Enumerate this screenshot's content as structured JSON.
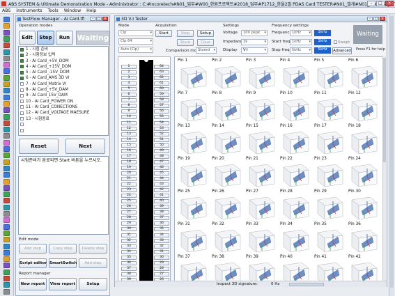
{
  "window": {
    "title": "ABS SYSTEM & Ultimate Demonstration Mode - Administrator : C:#Incoretech#N01_업무#W00_한원프로젝트#2018_업무#P1712_한울2발 PDAS Card TESTER#N01_발개#N01_PDAS Edge Tester#N05_"
  },
  "menu": [
    "ABS",
    "Instruments",
    "Tools",
    "Window",
    "Help"
  ],
  "left": {
    "title": "TestFlow Manager - AI Card.tfl",
    "operation_modes_label": "Operation modes",
    "modes": [
      "Edit",
      "Step",
      "Run"
    ],
    "active_mode": "Step",
    "waiting": "Waiting",
    "steps": [
      {
        "label": "1 - 시험 준비",
        "checked": true
      },
      {
        "label": "2 - 시험정보 입력",
        "checked": true
      },
      {
        "label": "3 - AI Card_+5V_DOM",
        "checked": true
      },
      {
        "label": "4 - AI Card_+15V_DOM",
        "checked": true
      },
      {
        "label": "5 - AI Card_-15V_DOM",
        "checked": true
      },
      {
        "label": "6 - AI Card_AMS 3D VI",
        "checked": true
      },
      {
        "label": "7 - AI Card_Matrix VI",
        "checked": false
      },
      {
        "label": "8 - AI Card_+5V_DAM",
        "checked": false
      },
      {
        "label": "9 - AI Card_15V_DAM",
        "checked": false
      },
      {
        "label": "10 - AI Card_POWER ON",
        "checked": false
      },
      {
        "label": "11 - AI Card_CONECTIONS",
        "checked": false
      },
      {
        "label": "12 - AI Card_VOLTAGE MAESURE",
        "checked": false
      },
      {
        "label": "13 - 시험종료",
        "checked": false
      },
      {
        "label": "",
        "checked": false
      },
      {
        "label": "",
        "checked": false
      }
    ],
    "reset": "Reset",
    "next": "Next",
    "message": "시험준비가 완료되면 Start 버튼을 누르시오.",
    "edit_mode_label": "Edit mode",
    "edit_buttons": [
      "Add step",
      "Copy step",
      "Delete step",
      "Script editor",
      "SmartSwitch",
      "Add step"
    ],
    "report_label": "Report manager",
    "report_buttons": [
      "New report",
      "View report",
      "Setup"
    ]
  },
  "tester": {
    "title": "3D V-I Tester",
    "mode_label": "Mode",
    "mode_combos": [
      "Clp",
      "Clp 64",
      "Auto (Clp)"
    ],
    "acq_label": "Acquisition",
    "acq_buttons": [
      "Start",
      "Stop",
      "Setup",
      "Store",
      "Clear"
    ],
    "comparison_label": "Comparison mode",
    "comparison_value": "Stored",
    "settings_label": "Settings",
    "voltage_label": "Voltage",
    "voltage_value": "10V pkpk",
    "impedance_label": "Impedance",
    "impedance_value": "1k",
    "display_label": "Display",
    "display_value": "V-I",
    "freq_label": "Frequency settings",
    "frequency_label": "Frequency",
    "frequency_combo": "1kHz",
    "frequency_value": "1kHz",
    "start_label": "Start freq.",
    "start_combo": "1kHz",
    "start_value": "1kHz",
    "stop_label": "Stop freq.",
    "stop_combo": "5kHz",
    "stop_value": "5kHz",
    "swept": "Swept",
    "advanced": "Advanced",
    "waiting": "Waiting",
    "help_hint": "Press F1 for help",
    "pins_left": [
      "1",
      "2",
      "3",
      "4",
      "5",
      "6",
      "7",
      "8",
      "9",
      "10",
      "11",
      "12",
      "13",
      "14",
      "15",
      "16",
      "17",
      "18",
      "19",
      "20",
      "21",
      "22",
      "23",
      "24",
      "25",
      "26",
      "27",
      "28",
      "29",
      "30",
      "31",
      "32",
      "33",
      "34",
      "35",
      "36",
      "37",
      "38",
      "39",
      "40"
    ],
    "pins_right": [
      "64",
      "63",
      "62",
      "61",
      "60",
      "59",
      "58",
      "57",
      "56",
      "55",
      "54",
      "53",
      "52",
      "51",
      "50",
      "49",
      "48",
      "47",
      "46",
      "45",
      "44",
      "43",
      "42",
      "41",
      "40",
      "39",
      "38",
      "37",
      "36",
      "35",
      "34",
      "33",
      "32",
      "31",
      "30",
      "29",
      "28",
      "27",
      "26",
      "25"
    ],
    "cells": [
      "Pin 1",
      "Pin 2",
      "Pin 3",
      "Pin 4",
      "Pin 5",
      "Pin 6",
      "Pin 7",
      "Pin 8",
      "Pin 9",
      "Pin 10",
      "Pin 11",
      "Pin 12",
      "Pin 13",
      "Pin 14",
      "Pin 15",
      "Pin 16",
      "Pin 17",
      "Pin 18",
      "Pin 19",
      "Pin 20",
      "Pin 21",
      "Pin 22",
      "Pin 23",
      "Pin 24",
      "Pin 25",
      "Pin 26",
      "Pin 27",
      "Pin 28",
      "Pin 29",
      "Pin 30",
      "Pin 31",
      "Pin 32",
      "Pin 33",
      "Pin 34",
      "Pin 35",
      "Pin 36",
      "Pin 37",
      "Pin 38",
      "Pin 39",
      "Pin 40",
      "Pin 41",
      "Pin 42"
    ],
    "status_label": "Inspect 3D signature:",
    "status_value": "0 Hz"
  }
}
